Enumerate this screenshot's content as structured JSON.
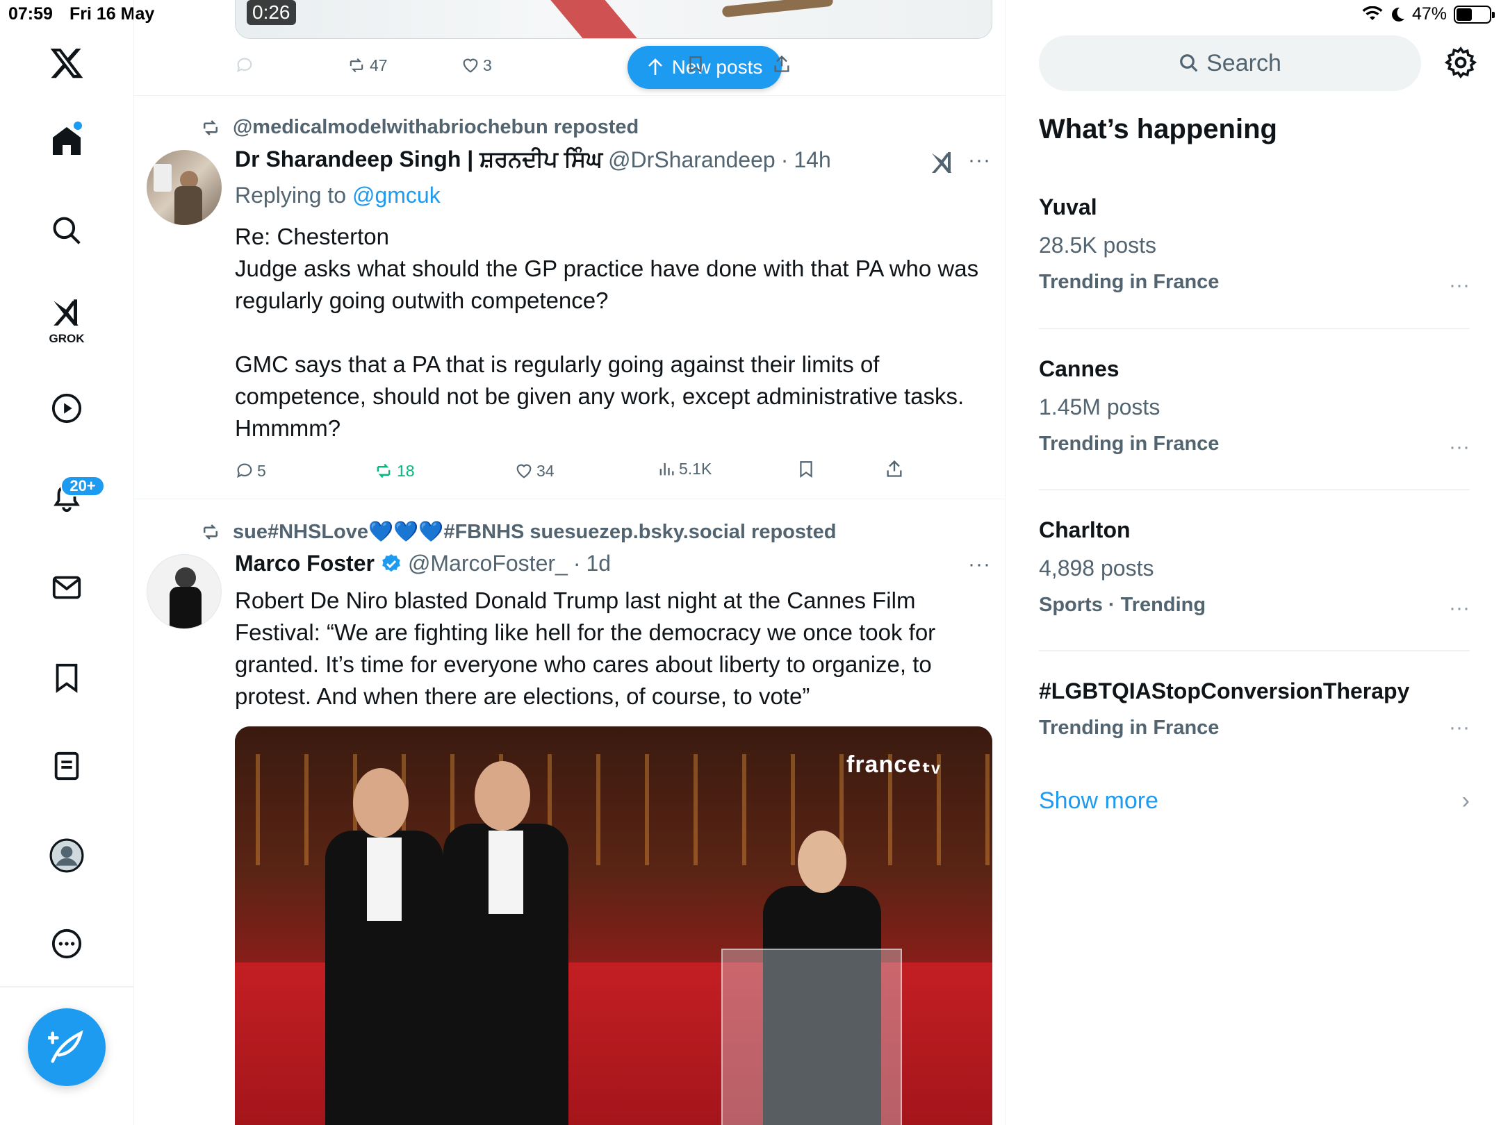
{
  "status_bar": {
    "time": "07:59",
    "date": "Fri 16 May",
    "battery": "47%",
    "battery_level": 0.47
  },
  "nav": {
    "grok_label": "GROK",
    "notifications_badge": "20+",
    "icons": [
      "x-logo-icon",
      "home-icon",
      "search-icon",
      "grok-icon",
      "video-icon",
      "bell-icon",
      "mail-icon",
      "bookmark-icon",
      "lists-icon",
      "profile-icon",
      "more-icon",
      "compose-icon"
    ]
  },
  "top_post": {
    "video_time": "0:26",
    "retweets": "47",
    "likes": "3",
    "new_posts_label": "New posts"
  },
  "post1": {
    "reposted_by": "@medicalmodelwithabriochebun reposted",
    "name": "Dr Sharandeep Singh | ਸ਼ਰਨਦੀਪ ਸਿੰਘ",
    "handle": "@DrSharandeep",
    "time": "14h",
    "replying_prefix": "Replying to ",
    "replying_to": "@gmcuk",
    "text": "Re: Chesterton\nJudge asks what should the GP practice have done with that PA who was regularly going outwith competence?\n\nGMC says that a PA that is regularly going against their limits of competence, should not be given any work, except administrative tasks. Hmmmm?",
    "replies": "5",
    "reposts": "18",
    "likes": "34",
    "views": "5.1K"
  },
  "post2": {
    "reposted_by": "sue#NHSLove💙💙💙#FBNHS suesuezep.bsky.social reposted",
    "name": "Marco Foster",
    "handle": "@MarcoFoster_",
    "time": "1d",
    "text": "Robert De Niro blasted Donald Trump last night at the Cannes Film Festival: “We are fighting like hell for the democracy we once took for granted. It’s time for everyone who cares about liberty to organize, to protest. And when there are elections, of course, to vote”",
    "video_overlay": "franceₜᵥ"
  },
  "sidebar": {
    "search_placeholder": "Search",
    "title": "What’s happening",
    "trends": [
      {
        "name": "Yuval",
        "posts": "28.5K posts",
        "context": "Trending in France"
      },
      {
        "name": "Cannes",
        "posts": "1.45M posts",
        "context": "Trending in France"
      },
      {
        "name": "Charlton",
        "posts": "4,898 posts",
        "context": "Sports · Trending"
      },
      {
        "name": "#LGBTQIAStopConversionTherapy",
        "posts": "",
        "context": "Trending in France"
      }
    ],
    "show_more": "Show more"
  },
  "colors": {
    "accent": "#1d9bf0",
    "secondary_text": "#536471",
    "repost_green": "#00ba7c"
  }
}
